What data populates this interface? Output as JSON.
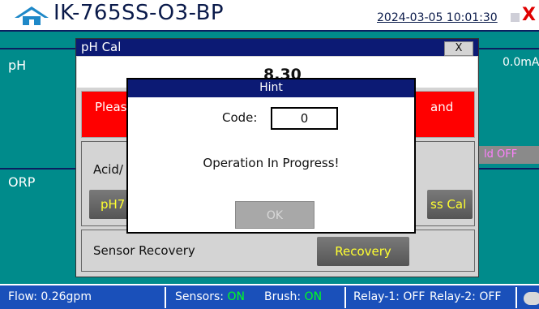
{
  "header": {
    "device_name": "IK-765SS-O3-BP",
    "datetime": "2024-03-05 10:01:30",
    "home_icon": "home-icon",
    "alarm_icon": "close-icon",
    "alarm_text": "X"
  },
  "main": {
    "ph_label": "pH",
    "ph_output": "0.0mA",
    "orp_label": "ORP",
    "hold_status": "ld OFF",
    "hold_prefix": ""
  },
  "ph_cal_dialog": {
    "title": "pH Cal",
    "close_label": "X",
    "current_value": "8.30",
    "warning_left": "Pleas",
    "warning_right": "and",
    "acid_label": "Acid/",
    "ph7_label": "pH7",
    "press_cal_label": "ss Cal",
    "sensor_recovery_label": "Sensor Recovery",
    "recovery_label": "Recovery"
  },
  "hint_dialog": {
    "title": "Hint",
    "code_label": "Code:",
    "code_value": "0",
    "message": "Operation In Progress!",
    "ok_label": "OK"
  },
  "status_bar": {
    "flow_label": "Flow:",
    "flow_value": "0.26gpm",
    "sensors_label": "Sensors:",
    "sensors_value": "ON",
    "brush_label": "Brush:",
    "brush_value": "ON",
    "relay1_label": "Relay-1:",
    "relay1_value": "OFF",
    "relay2_label": "Relay-2:",
    "relay2_value": "OFF"
  },
  "colors": {
    "main_bg": "#008b8b",
    "title_blue": "#0c1a74",
    "status_blue": "#1a50ba",
    "button_text": "#ffff30",
    "on_green": "#00ff20",
    "warning_red": "#ff0000"
  }
}
